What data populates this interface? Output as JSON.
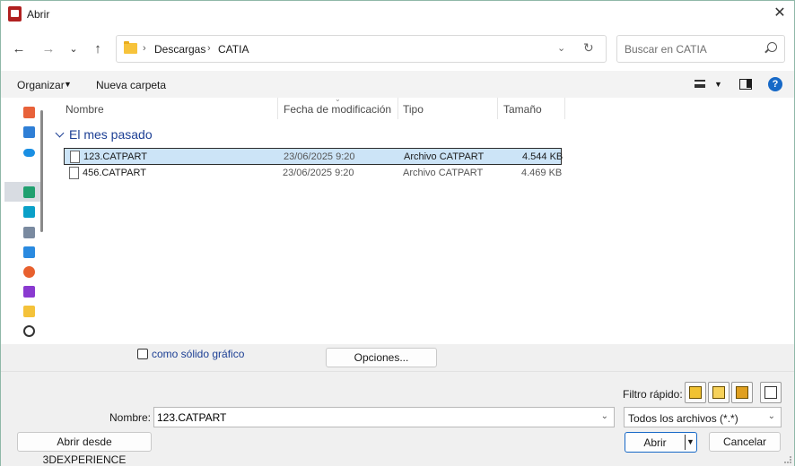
{
  "window": {
    "title": "Abrir"
  },
  "navigation": {
    "breadcrumb": [
      "Descargas",
      "CATIA"
    ],
    "search_placeholder": "Buscar en CATIA"
  },
  "toolbar": {
    "organize_label": "Organizar",
    "new_folder_label": "Nueva carpeta"
  },
  "columns": [
    "Nombre",
    "Fecha de modificación",
    "Tipo",
    "Tamaño"
  ],
  "group": {
    "label": "El mes pasado"
  },
  "files": [
    {
      "name": "123.CATPART",
      "date": "23/06/2025 9:20",
      "type": "Archivo CATPART",
      "size": "4.544 KB",
      "selected": true
    },
    {
      "name": "456.CATPART",
      "date": "23/06/2025 9:20",
      "type": "Archivo CATPART",
      "size": "4.469 KB",
      "selected": false
    }
  ],
  "options": {
    "graphic_solid_label": "como sólido gráfico",
    "options_button": "Opciones..."
  },
  "bottom": {
    "quick_filter_label": "Filtro rápido:",
    "name_label": "Nombre:",
    "name_value": "123.CATPART",
    "file_type": "Todos los archivos (*.*)",
    "open_label": "Abrir",
    "cancel_label": "Cancelar",
    "open_3dx_label": "Abrir desde 3DEXPERIENCE"
  },
  "colors": {
    "accent": "#1769c7",
    "selection": "#cce4f7",
    "group_header": "#1c3f94"
  }
}
